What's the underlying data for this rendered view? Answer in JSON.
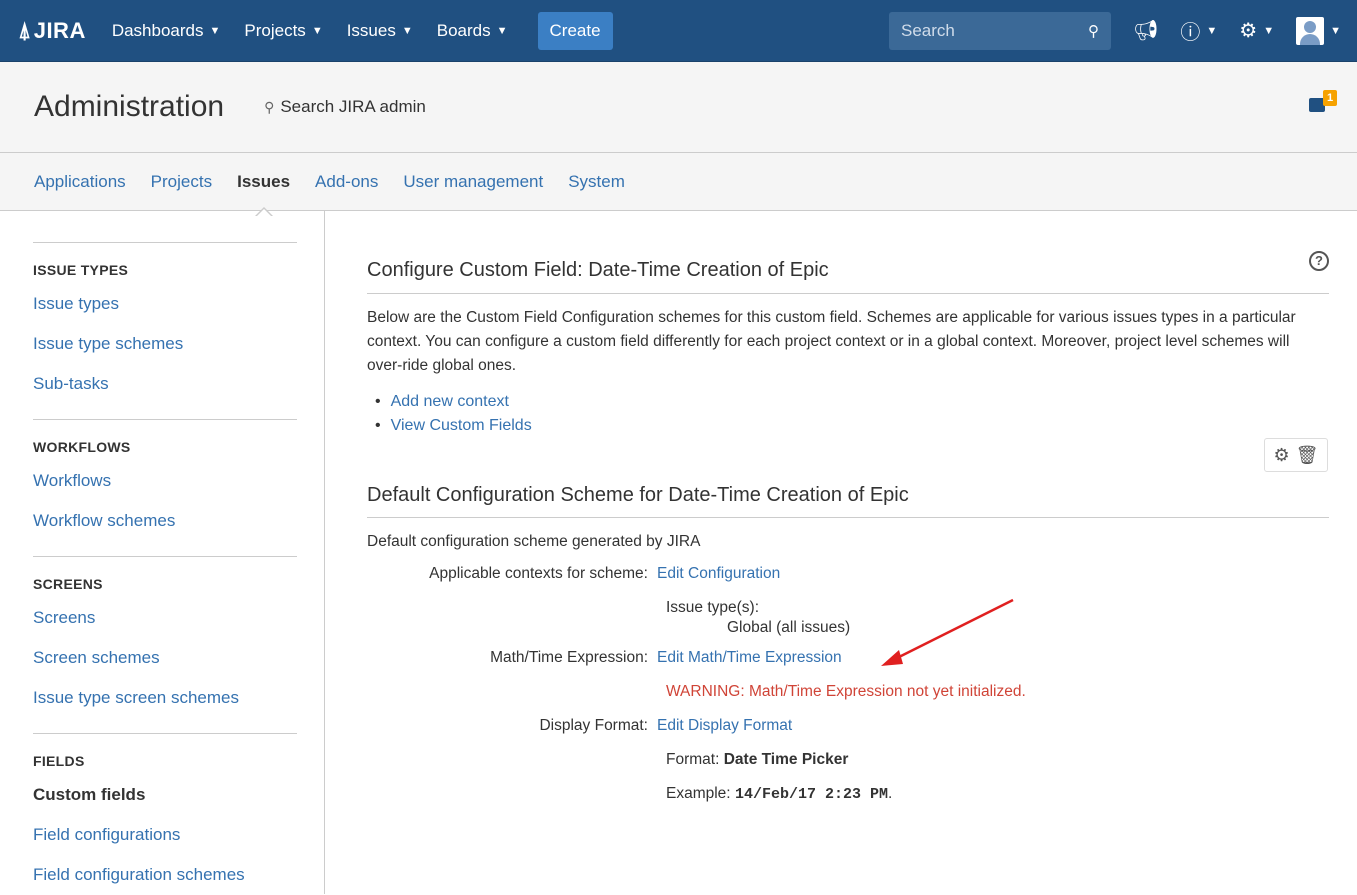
{
  "topnav": {
    "logo": "JIRA",
    "items": [
      {
        "label": "Dashboards"
      },
      {
        "label": "Projects"
      },
      {
        "label": "Issues"
      },
      {
        "label": "Boards"
      }
    ],
    "create_label": "Create",
    "search_placeholder": "Search"
  },
  "admin": {
    "title": "Administration",
    "search_label": "Search JIRA admin",
    "feedback_badge": "1"
  },
  "tabs": [
    {
      "label": "Applications"
    },
    {
      "label": "Projects"
    },
    {
      "label": "Issues"
    },
    {
      "label": "Add-ons"
    },
    {
      "label": "User management"
    },
    {
      "label": "System"
    }
  ],
  "sidebar": {
    "groups": [
      {
        "heading": "ISSUE TYPES",
        "items": [
          "Issue types",
          "Issue type schemes",
          "Sub-tasks"
        ]
      },
      {
        "heading": "WORKFLOWS",
        "items": [
          "Workflows",
          "Workflow schemes"
        ]
      },
      {
        "heading": "SCREENS",
        "items": [
          "Screens",
          "Screen schemes",
          "Issue type screen schemes"
        ]
      },
      {
        "heading": "FIELDS",
        "items": [
          "Custom fields",
          "Field configurations",
          "Field configuration schemes"
        ]
      }
    ]
  },
  "main": {
    "title": "Configure Custom Field: Date-Time Creation of Epic",
    "description": "Below are the Custom Field Configuration schemes for this custom field. Schemes are applicable for various issues types in a particular context. You can configure a custom field differently for each project context or in a global context. Moreover, project level schemes will over-ride global ones.",
    "links": [
      "Add new context",
      "View Custom Fields"
    ],
    "scheme": {
      "title": "Default Configuration Scheme for Date-Time Creation of Epic",
      "description": "Default configuration scheme generated by JIRA",
      "contexts_label": "Applicable contexts for scheme:",
      "contexts_link": "Edit Configuration",
      "issue_types_label": "Issue type(s):",
      "issue_types_value": "Global (all issues)",
      "math_label": "Math/Time Expression:",
      "math_link": "Edit Math/Time Expression",
      "warning": "WARNING: Math/Time Expression not yet initialized.",
      "display_label": "Display Format:",
      "display_link": "Edit Display Format",
      "format_label": "Format:",
      "format_value": "Date Time Picker",
      "example_label": "Example:",
      "example_value": "14/Feb/17 2:23 PM",
      "example_suffix": "."
    }
  },
  "colors": {
    "nav_bg": "#205081",
    "link": "#3572b0",
    "warning": "#d04437",
    "arrow": "#e02020",
    "badge": "#f6a200"
  }
}
